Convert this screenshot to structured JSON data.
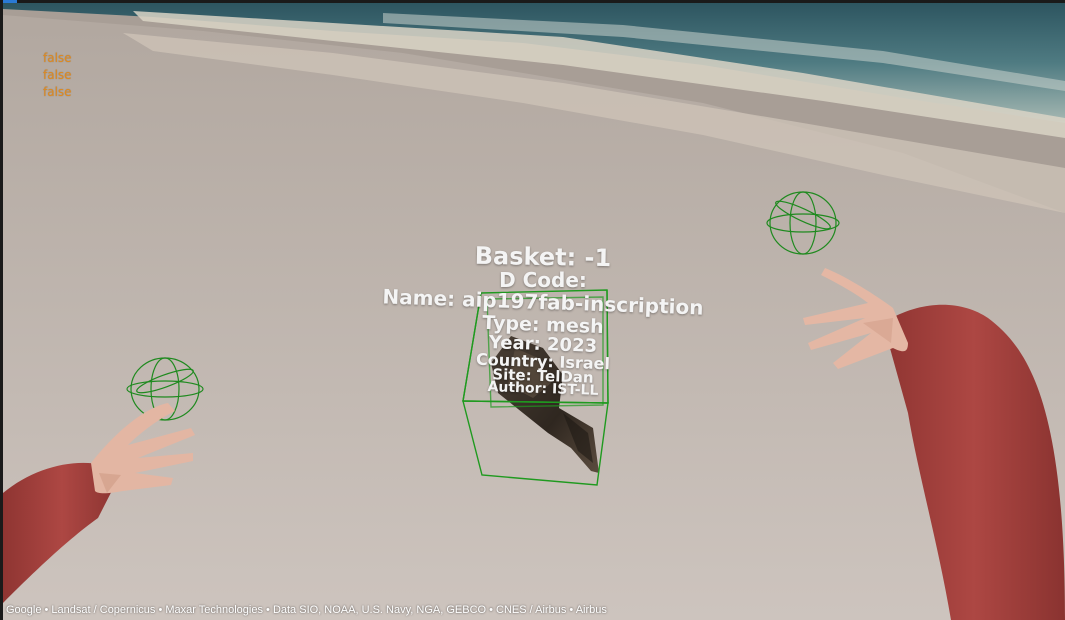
{
  "debug_flags": [
    "false",
    "false",
    "false"
  ],
  "artifact_info": {
    "basket": "Basket: -1",
    "d_code": "D Code:",
    "name": "Name: aip197fab-inscription",
    "type": "Type: mesh",
    "year": "Year: 2023",
    "country": "Country: Israel",
    "site": "Site: TelDan",
    "author": "Author: IST-LL"
  },
  "attribution": "Google • Landsat / Copernicus • Maxar Technologies • Data SIO, NOAA, U.S. Navy, NGA, GEBCO • CNES / Airbus • Airbus",
  "colors": {
    "debug_text": "#e08a1e",
    "bounding_box": "#1f9a1f",
    "gizmo": "#1f8a1f",
    "sleeve": "#a9423e",
    "ground": "#bdb4ae"
  }
}
